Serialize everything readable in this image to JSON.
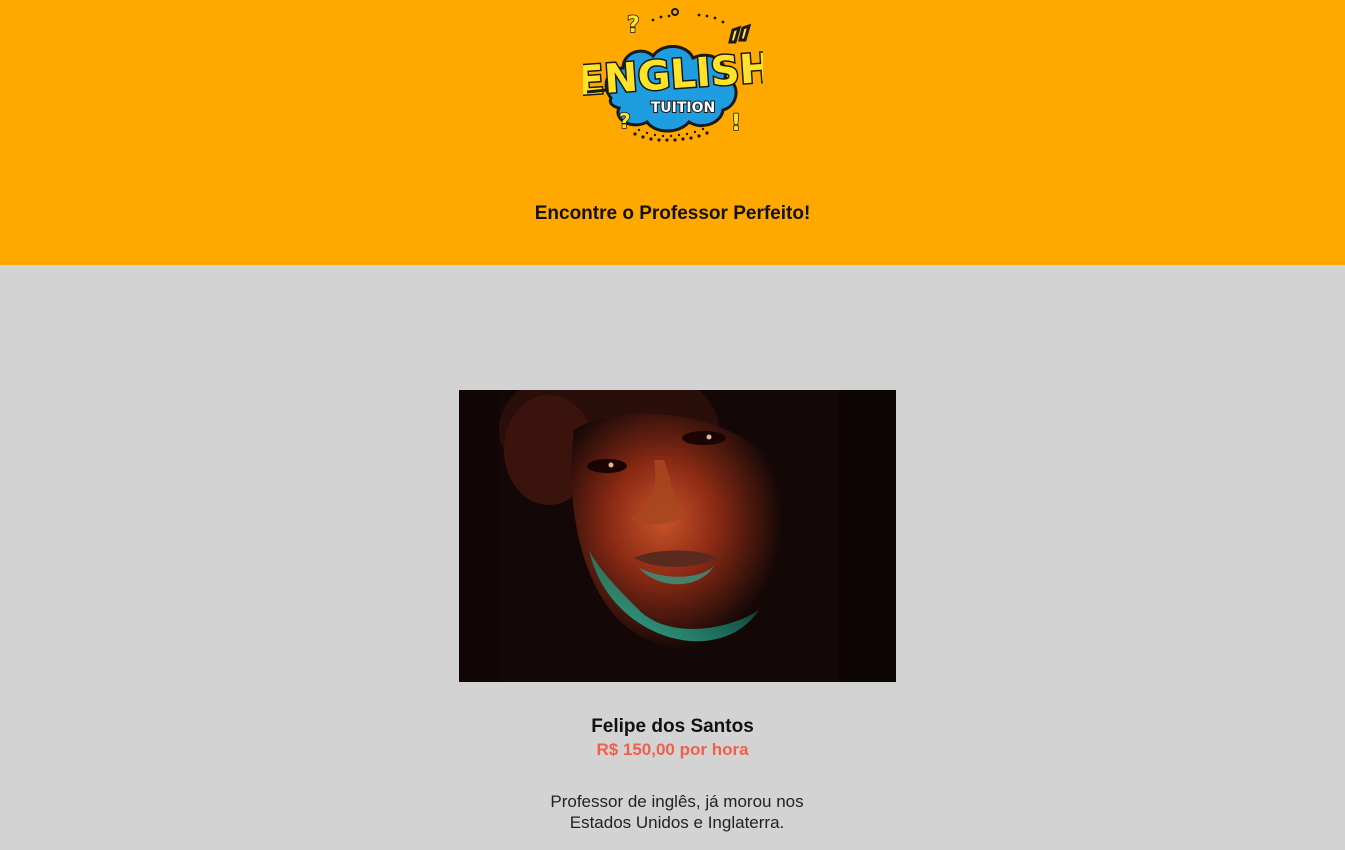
{
  "header": {
    "logo": {
      "line1": "ENGLISH",
      "line2": "TUITION",
      "icon": "english-tuition-logo",
      "colors": {
        "yellow": "#ffe32b",
        "blue": "#1e9de0",
        "dark": "#1a1a1a"
      }
    },
    "tagline": "Encontre o Professor Perfeito!"
  },
  "teacher": {
    "photo_icon": "teacher-portrait-photo",
    "name": "Felipe dos Santos",
    "price": "R$ 150,00 por hora",
    "description": "Professor de inglês, já morou nos Estados Unidos e Inglaterra."
  },
  "colors": {
    "header_bg": "#ffa800",
    "page_bg": "#d3d3d3",
    "price": "#f0604d"
  }
}
